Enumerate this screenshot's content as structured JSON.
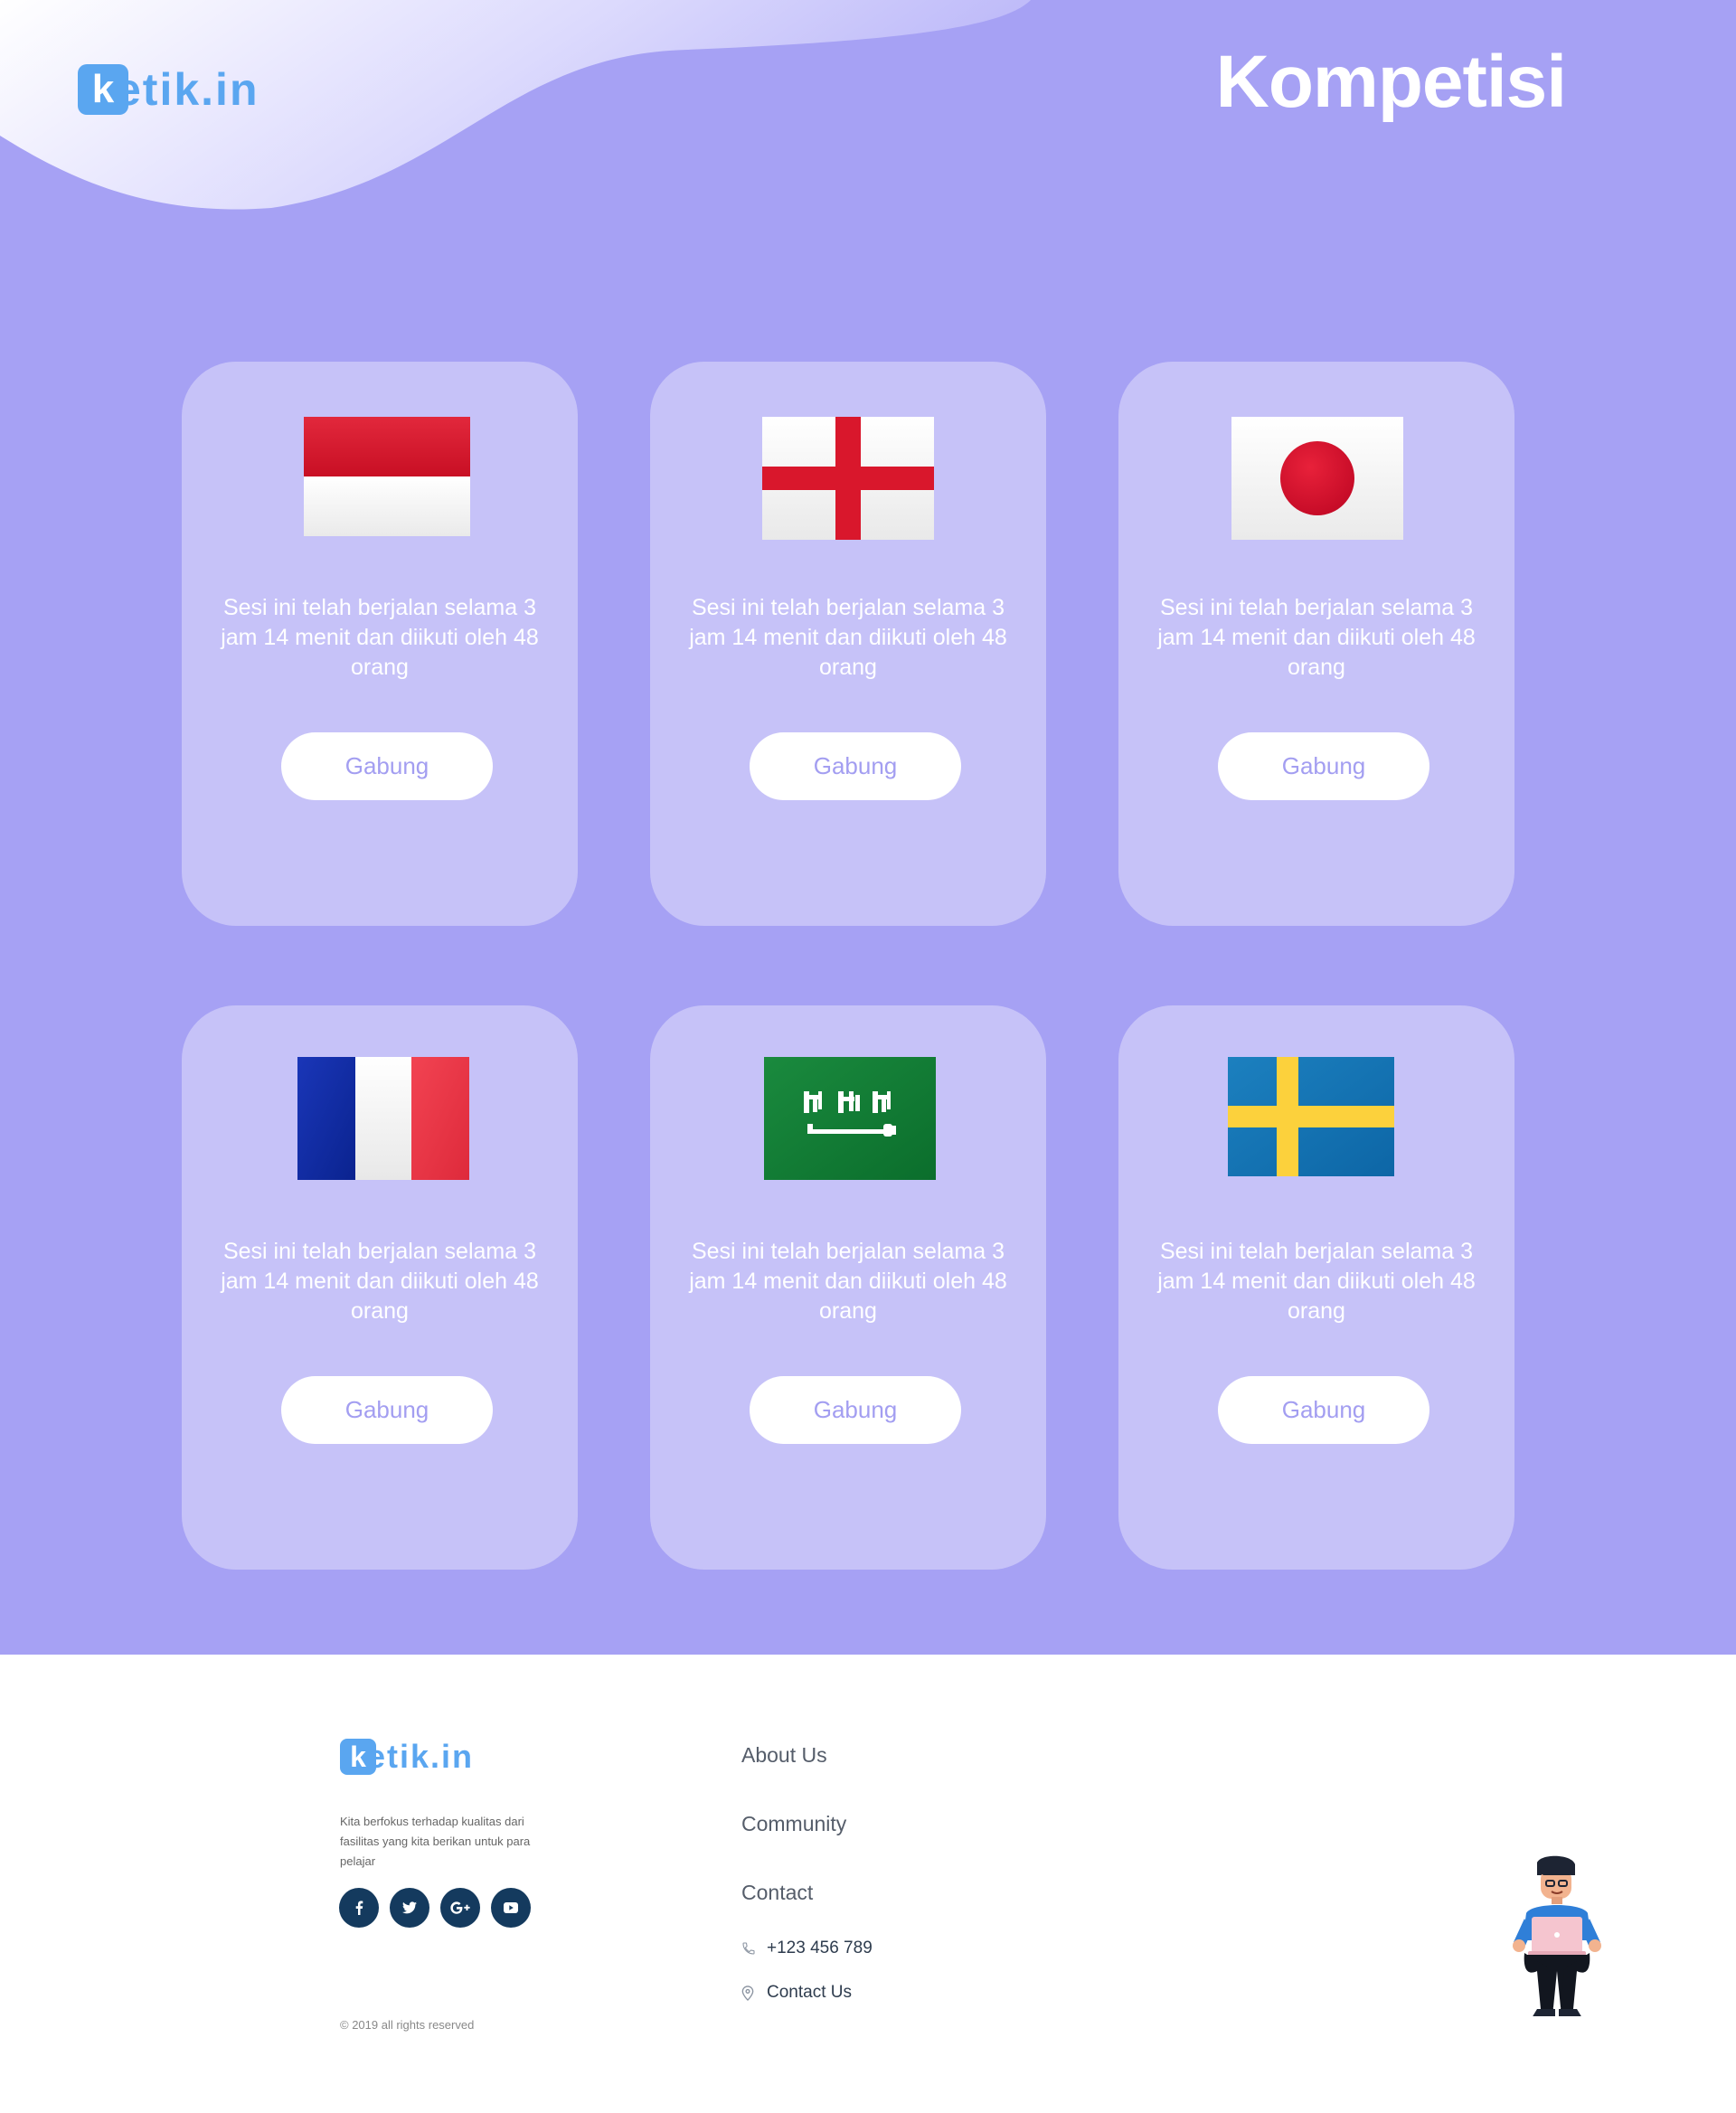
{
  "brand": {
    "logo_letter": "k",
    "logo_rest": "etik.in",
    "color": "#5aa6f0"
  },
  "header": {
    "title": "Kompetisi"
  },
  "theme": {
    "hero_bg": "#a6a1f4",
    "card_bg": "#c6c2f8",
    "button_text": "#a39ef1",
    "footer_icon_bg": "#143a5e"
  },
  "competitions": [
    {
      "flag": "indonesia-flag",
      "text": "Sesi ini telah berjalan selama 3 jam 14 menit dan diikuti oleh 48 orang",
      "button": "Gabung"
    },
    {
      "flag": "england-flag",
      "text": "Sesi ini telah berjalan selama 3 jam 14 menit dan diikuti oleh 48 orang",
      "button": "Gabung"
    },
    {
      "flag": "japan-flag",
      "text": "Sesi ini telah berjalan selama 3 jam 14 menit dan diikuti oleh 48 orang",
      "button": "Gabung"
    },
    {
      "flag": "france-flag",
      "text": "Sesi ini telah berjalan selama 3 jam 14 menit dan diikuti oleh 48 orang",
      "button": "Gabung"
    },
    {
      "flag": "saudi-arabia-flag",
      "text": "Sesi ini telah berjalan selama 3 jam 14 menit dan diikuti oleh 48 orang",
      "button": "Gabung"
    },
    {
      "flag": "sweden-flag",
      "text": "Sesi ini telah berjalan selama 3 jam 14 menit dan diikuti oleh 48 orang",
      "button": "Gabung"
    }
  ],
  "footer": {
    "description": "Kita berfokus terhadap kualitas dari fasilitas yang kita berikan untuk para pelajar",
    "socials": [
      "facebook-icon",
      "twitter-icon",
      "google-plus-icon",
      "youtube-icon"
    ],
    "links": [
      "About Us",
      "Community",
      "Contact"
    ],
    "phone": "+123 456 789",
    "contact_us": "Contact Us",
    "copyright": "© 2019 all rights reserved"
  }
}
